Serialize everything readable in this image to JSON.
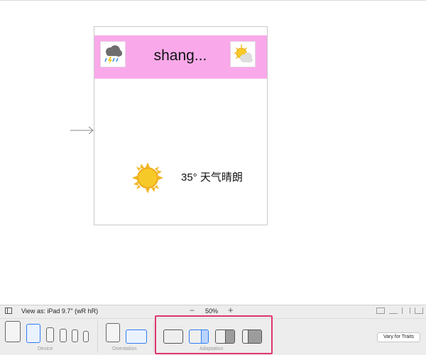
{
  "scene": {
    "title": "shang...",
    "weather_text": "35° 天气晴朗",
    "header_color": "#f9a9ea",
    "left_icon": "storm-cloud-icon",
    "right_icon": "sun-behind-cloud-icon",
    "main_icon": "sun-icon"
  },
  "toolbar": {
    "view_as_label": "View as: iPad 9.7\" (wR hR)",
    "zoom_level": "50%",
    "zoom_out": "−",
    "zoom_in": "+",
    "device_label": "Device",
    "orientation_label": "Orientation",
    "adaptation_label": "Adaptation",
    "vary_button": "Vary for Traits"
  },
  "colors": {
    "selection_blue": "#2f7cf6",
    "highlight_red": "#e0356f"
  }
}
